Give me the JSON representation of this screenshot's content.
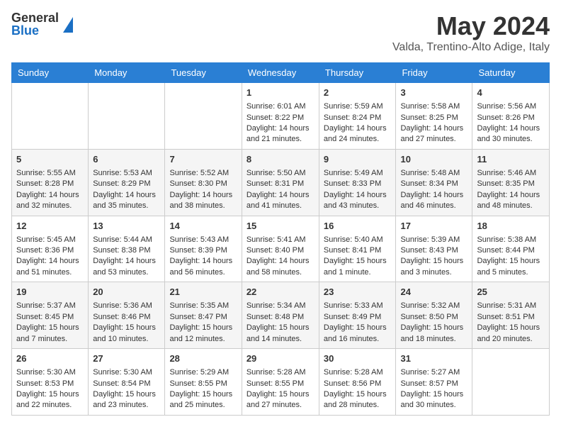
{
  "header": {
    "logo": {
      "general": "General",
      "blue": "Blue"
    },
    "title": "May 2024",
    "location": "Valda, Trentino-Alto Adige, Italy"
  },
  "days_of_week": [
    "Sunday",
    "Monday",
    "Tuesday",
    "Wednesday",
    "Thursday",
    "Friday",
    "Saturday"
  ],
  "weeks": [
    [
      {
        "day": "",
        "content": ""
      },
      {
        "day": "",
        "content": ""
      },
      {
        "day": "",
        "content": ""
      },
      {
        "day": "1",
        "content": "Sunrise: 6:01 AM\nSunset: 8:22 PM\nDaylight: 14 hours\nand 21 minutes."
      },
      {
        "day": "2",
        "content": "Sunrise: 5:59 AM\nSunset: 8:24 PM\nDaylight: 14 hours\nand 24 minutes."
      },
      {
        "day": "3",
        "content": "Sunrise: 5:58 AM\nSunset: 8:25 PM\nDaylight: 14 hours\nand 27 minutes."
      },
      {
        "day": "4",
        "content": "Sunrise: 5:56 AM\nSunset: 8:26 PM\nDaylight: 14 hours\nand 30 minutes."
      }
    ],
    [
      {
        "day": "5",
        "content": "Sunrise: 5:55 AM\nSunset: 8:28 PM\nDaylight: 14 hours\nand 32 minutes."
      },
      {
        "day": "6",
        "content": "Sunrise: 5:53 AM\nSunset: 8:29 PM\nDaylight: 14 hours\nand 35 minutes."
      },
      {
        "day": "7",
        "content": "Sunrise: 5:52 AM\nSunset: 8:30 PM\nDaylight: 14 hours\nand 38 minutes."
      },
      {
        "day": "8",
        "content": "Sunrise: 5:50 AM\nSunset: 8:31 PM\nDaylight: 14 hours\nand 41 minutes."
      },
      {
        "day": "9",
        "content": "Sunrise: 5:49 AM\nSunset: 8:33 PM\nDaylight: 14 hours\nand 43 minutes."
      },
      {
        "day": "10",
        "content": "Sunrise: 5:48 AM\nSunset: 8:34 PM\nDaylight: 14 hours\nand 46 minutes."
      },
      {
        "day": "11",
        "content": "Sunrise: 5:46 AM\nSunset: 8:35 PM\nDaylight: 14 hours\nand 48 minutes."
      }
    ],
    [
      {
        "day": "12",
        "content": "Sunrise: 5:45 AM\nSunset: 8:36 PM\nDaylight: 14 hours\nand 51 minutes."
      },
      {
        "day": "13",
        "content": "Sunrise: 5:44 AM\nSunset: 8:38 PM\nDaylight: 14 hours\nand 53 minutes."
      },
      {
        "day": "14",
        "content": "Sunrise: 5:43 AM\nSunset: 8:39 PM\nDaylight: 14 hours\nand 56 minutes."
      },
      {
        "day": "15",
        "content": "Sunrise: 5:41 AM\nSunset: 8:40 PM\nDaylight: 14 hours\nand 58 minutes."
      },
      {
        "day": "16",
        "content": "Sunrise: 5:40 AM\nSunset: 8:41 PM\nDaylight: 15 hours\nand 1 minute."
      },
      {
        "day": "17",
        "content": "Sunrise: 5:39 AM\nSunset: 8:43 PM\nDaylight: 15 hours\nand 3 minutes."
      },
      {
        "day": "18",
        "content": "Sunrise: 5:38 AM\nSunset: 8:44 PM\nDaylight: 15 hours\nand 5 minutes."
      }
    ],
    [
      {
        "day": "19",
        "content": "Sunrise: 5:37 AM\nSunset: 8:45 PM\nDaylight: 15 hours\nand 7 minutes."
      },
      {
        "day": "20",
        "content": "Sunrise: 5:36 AM\nSunset: 8:46 PM\nDaylight: 15 hours\nand 10 minutes."
      },
      {
        "day": "21",
        "content": "Sunrise: 5:35 AM\nSunset: 8:47 PM\nDaylight: 15 hours\nand 12 minutes."
      },
      {
        "day": "22",
        "content": "Sunrise: 5:34 AM\nSunset: 8:48 PM\nDaylight: 15 hours\nand 14 minutes."
      },
      {
        "day": "23",
        "content": "Sunrise: 5:33 AM\nSunset: 8:49 PM\nDaylight: 15 hours\nand 16 minutes."
      },
      {
        "day": "24",
        "content": "Sunrise: 5:32 AM\nSunset: 8:50 PM\nDaylight: 15 hours\nand 18 minutes."
      },
      {
        "day": "25",
        "content": "Sunrise: 5:31 AM\nSunset: 8:51 PM\nDaylight: 15 hours\nand 20 minutes."
      }
    ],
    [
      {
        "day": "26",
        "content": "Sunrise: 5:30 AM\nSunset: 8:53 PM\nDaylight: 15 hours\nand 22 minutes."
      },
      {
        "day": "27",
        "content": "Sunrise: 5:30 AM\nSunset: 8:54 PM\nDaylight: 15 hours\nand 23 minutes."
      },
      {
        "day": "28",
        "content": "Sunrise: 5:29 AM\nSunset: 8:55 PM\nDaylight: 15 hours\nand 25 minutes."
      },
      {
        "day": "29",
        "content": "Sunrise: 5:28 AM\nSunset: 8:55 PM\nDaylight: 15 hours\nand 27 minutes."
      },
      {
        "day": "30",
        "content": "Sunrise: 5:28 AM\nSunset: 8:56 PM\nDaylight: 15 hours\nand 28 minutes."
      },
      {
        "day": "31",
        "content": "Sunrise: 5:27 AM\nSunset: 8:57 PM\nDaylight: 15 hours\nand 30 minutes."
      },
      {
        "day": "",
        "content": ""
      }
    ]
  ]
}
